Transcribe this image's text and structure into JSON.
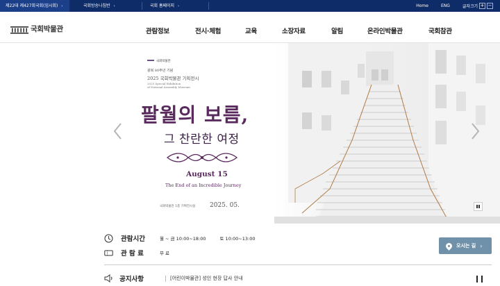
{
  "topbar": {
    "links": [
      {
        "label": "제22대 제427회국회(임시회)"
      },
      {
        "label": "국회방송나침반"
      },
      {
        "label": "국회 홈페이지"
      }
    ],
    "home": "Home",
    "eng": "ENG",
    "font_size_label": "글자크기",
    "font_plus": "+",
    "font_minus": "−"
  },
  "header": {
    "logo_text": "국회박물관",
    "menu": [
      {
        "label": "관람정보"
      },
      {
        "label": "전시·체험"
      },
      {
        "label": "교육"
      },
      {
        "label": "소장자료"
      },
      {
        "label": "알림"
      },
      {
        "label": "온라인박물관"
      },
      {
        "label": "국회참관"
      }
    ]
  },
  "hero": {
    "museum_logo": "국회박물관",
    "line1": "광복 80주년 기념",
    "line2": "2025 국회박물관 기획전시",
    "line3": "2025 Special Exhibition",
    "line4": "of National Assembly Museum",
    "title": "팔월의 보름,",
    "subtitle": "그 찬란한 여정",
    "date_en": "August 15",
    "title_en": "The End of an Incredible Journey",
    "place": "국회박물관 1층 기획전시실",
    "date": "2025. 05."
  },
  "info": {
    "hours_label": "관람시간",
    "hours_weekday": "월 ~ 금  10:00~18:00",
    "hours_sat": "토  10:00~13:00",
    "fee_label": "관 람 료",
    "fee_value": "무  료",
    "directions_label": "오시는 길",
    "notice_label": "공지사항",
    "notice_text": "[어린이박물관] 성인 현장 답사 안내"
  },
  "colors": {
    "topbar_bg": "#0e2c68",
    "title_purple": "#5a2a5e",
    "directions_bg": "#6f91a9"
  }
}
